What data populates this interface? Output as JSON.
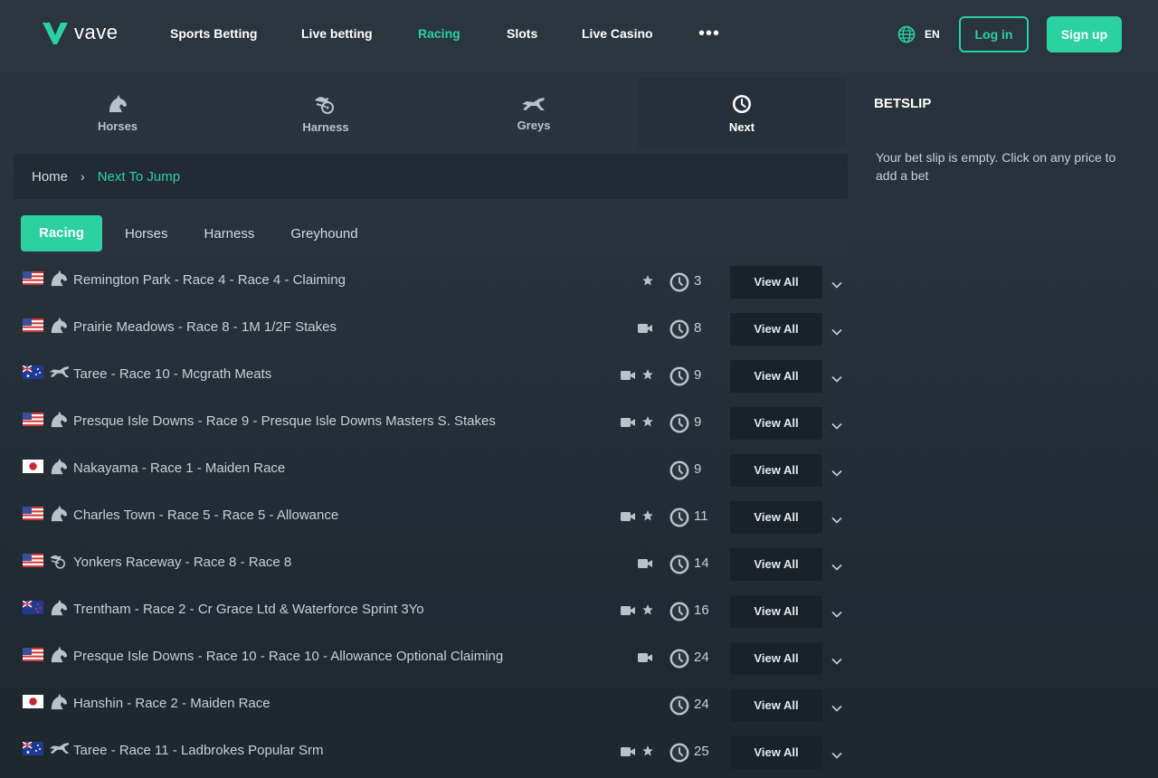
{
  "brand": {
    "name": "vave",
    "accent": "#2bd1a1"
  },
  "nav": {
    "links": [
      "Sports Betting",
      "Live betting",
      "Racing",
      "Slots",
      "Live Casino"
    ],
    "active": "Racing",
    "more_icon": "more-dots-icon",
    "language": "EN",
    "login": "Log in",
    "signup": "Sign up"
  },
  "categories": [
    {
      "label": "Horses",
      "icon": "horse-icon"
    },
    {
      "label": "Harness",
      "icon": "harness-icon"
    },
    {
      "label": "Greys",
      "icon": "greyhound-icon"
    },
    {
      "label": "Next",
      "icon": "clock-icon",
      "active": true
    }
  ],
  "breadcrumb": {
    "home": "Home",
    "current": "Next To Jump"
  },
  "filters": {
    "items": [
      "Racing",
      "Horses",
      "Harness",
      "Greyhound"
    ],
    "active": "Racing"
  },
  "races": [
    {
      "flag": "us",
      "type": "horse",
      "name": "Remington Park - Race 4 - Race 4 - Claiming",
      "video": false,
      "star": true,
      "mins": "3",
      "action": "View All"
    },
    {
      "flag": "us",
      "type": "horse",
      "name": "Prairie Meadows - Race 8 - 1M 1/2F Stakes",
      "video": true,
      "star": false,
      "mins": "8",
      "action": "View All"
    },
    {
      "flag": "au",
      "type": "greyhound",
      "name": "Taree - Race 10 - Mcgrath Meats",
      "video": true,
      "star": true,
      "mins": "9",
      "action": "View All"
    },
    {
      "flag": "us",
      "type": "horse",
      "name": "Presque Isle Downs - Race 9 - Presque Isle Downs Masters S. Stakes",
      "video": true,
      "star": true,
      "mins": "9",
      "action": "View All"
    },
    {
      "flag": "jp",
      "type": "horse",
      "name": "Nakayama - Race 1 - Maiden Race",
      "video": false,
      "star": false,
      "mins": "9",
      "action": "View All"
    },
    {
      "flag": "us",
      "type": "horse",
      "name": "Charles Town - Race 5 - Race 5 - Allowance",
      "video": true,
      "star": true,
      "mins": "11",
      "action": "View All"
    },
    {
      "flag": "us",
      "type": "harness",
      "name": "Yonkers Raceway - Race 8 - Race 8",
      "video": true,
      "star": false,
      "mins": "14",
      "action": "View All"
    },
    {
      "flag": "nz",
      "type": "horse",
      "name": "Trentham - Race 2 - Cr Grace Ltd & Waterforce Sprint 3Yo",
      "video": true,
      "star": true,
      "mins": "16",
      "action": "View All"
    },
    {
      "flag": "us",
      "type": "horse",
      "name": "Presque Isle Downs - Race 10 - Race 10 - Allowance Optional Claiming",
      "video": true,
      "star": false,
      "mins": "24",
      "action": "View All"
    },
    {
      "flag": "jp",
      "type": "horse",
      "name": "Hanshin - Race 2 - Maiden Race",
      "video": false,
      "star": false,
      "mins": "24",
      "action": "View All"
    },
    {
      "flag": "au",
      "type": "greyhound",
      "name": "Taree - Race 11 - Ladbrokes Popular Srm",
      "video": true,
      "star": true,
      "mins": "25",
      "action": "View All"
    }
  ],
  "betslip": {
    "title": "BETSLIP",
    "message": "Your bet slip is empty. Click on any price to add a bet"
  }
}
